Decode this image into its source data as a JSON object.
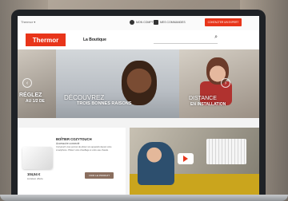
{
  "topbar": {
    "left_label": "Thermor ▾",
    "account_label": "MON COMPTE",
    "orders_label": "MES COMMANDES",
    "cta_label": "CONTACTER UN EXPERT"
  },
  "header": {
    "logo_text": "Thermor",
    "nav_label": "La Boutique",
    "search_placeholder": ""
  },
  "hero": {
    "left_text_1": "RÉGLEZ",
    "left_text_2": "AU 1/2 DE",
    "center_text_1": "DÉCOUVREZ",
    "center_text_2": "TROIS BONNES RAISONS",
    "center_text_3": "...",
    "right_text_1": "DISTANCE",
    "right_text_2": "EN INSTALLATION"
  },
  "product": {
    "title": "BOÎTIER COZYTOUCH",
    "subtitle": "Accessoire connecté",
    "description": "Cozytouch vous permet de piloter vos appareils depuis votre smartphone. Pilotez votre chauffage et votre eau chaude.",
    "price": "104,54 €",
    "shipping": "Livraison offerte",
    "button_label": "VOIR LE PRODUIT"
  }
}
